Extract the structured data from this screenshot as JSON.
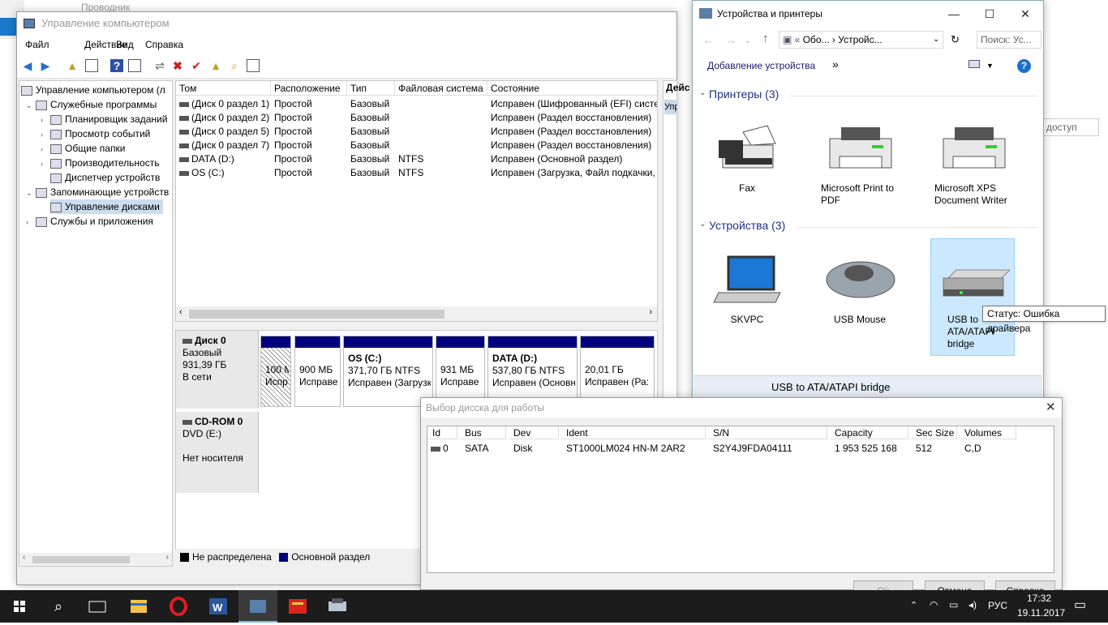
{
  "explorer_bg": {
    "title": "Проводник",
    "search_partial": "доступ"
  },
  "cm": {
    "title": "Управление компьютером",
    "menu": [
      "Файл",
      "Действие",
      "Вид",
      "Справка"
    ],
    "tree": [
      {
        "label": "Управление компьютером (л",
        "level": 0
      },
      {
        "label": "Служебные программы",
        "level": 1
      },
      {
        "label": "Планировщик заданий",
        "level": 2
      },
      {
        "label": "Просмотр событий",
        "level": 2
      },
      {
        "label": "Общие папки",
        "level": 2
      },
      {
        "label": "Производительность",
        "level": 2
      },
      {
        "label": "Диспетчер устройств",
        "level": 2
      },
      {
        "label": "Запоминающие устройств",
        "level": 1
      },
      {
        "label": "Управление дисками",
        "level": 2
      },
      {
        "label": "Службы и приложения",
        "level": 1
      }
    ],
    "columns": [
      "Том",
      "Расположение",
      "Тип",
      "Файловая система",
      "Состояние"
    ],
    "volumes": [
      [
        "(Диск 0 раздел 1)",
        "Простой",
        "Базовый",
        "",
        "Исправен (Шифрованный (EFI) систе"
      ],
      [
        "(Диск 0 раздел 2)",
        "Простой",
        "Базовый",
        "",
        "Исправен (Раздел восстановления)"
      ],
      [
        "(Диск 0 раздел 5)",
        "Простой",
        "Базовый",
        "",
        "Исправен (Раздел восстановления)"
      ],
      [
        "(Диск 0 раздел 7)",
        "Простой",
        "Базовый",
        "",
        "Исправен (Раздел восстановления)"
      ],
      [
        "DATA (D:)",
        "Простой",
        "Базовый",
        "NTFS",
        "Исправен (Основной раздел)"
      ],
      [
        "OS (C:)",
        "Простой",
        "Базовый",
        "NTFS",
        "Исправен (Загрузка, Файл подкачки,"
      ]
    ],
    "disk0": {
      "name": "Диск 0",
      "type": "Базовый",
      "size": "931,39 ГБ",
      "status": "В сети"
    },
    "partitions": [
      {
        "title": "",
        "line1": "100 М",
        "line2": "Испр"
      },
      {
        "title": "",
        "line1": "900 МБ",
        "line2": "Исправе"
      },
      {
        "title": "OS (C:)",
        "line1": "371,70 ГБ NTFS",
        "line2": "Исправен (Загрузк"
      },
      {
        "title": "",
        "line1": "931 МБ",
        "line2": "Исправе"
      },
      {
        "title": "DATA (D:)",
        "line1": "537,80 ГБ NTFS",
        "line2": "Исправен (Основн"
      },
      {
        "title": "",
        "line1": "20,01 ГБ",
        "line2": "Исправен (Ра:"
      }
    ],
    "cdrom": {
      "name": "CD-ROM 0",
      "drive": "DVD (E:)",
      "status": "Нет носителя"
    },
    "legend": [
      "Не распределена",
      "Основной раздел"
    ],
    "actions_header": "Дейс",
    "actions_item": "Управ"
  },
  "dp": {
    "title": "Устройства и принтеры",
    "address": [
      "Обо...",
      "Устройс..."
    ],
    "search_placeholder": "Поиск: Ус...",
    "add_device": "Добавление устройства",
    "more": "»",
    "printers_title": "Принтеры (3)",
    "printers": [
      "Fax",
      "Microsoft Print to PDF",
      "Microsoft XPS Document Writer"
    ],
    "devices_title": "Устройства (3)",
    "devices": [
      "SKVPC",
      "USB Mouse",
      "USB to ATA/ATAPI bridge"
    ],
    "tooltip": "Статус: Ошибка драйвера",
    "details_name": "USB to ATA/ATAPI bridge"
  },
  "sd": {
    "title": "Выбор дисска для работы",
    "columns": [
      "Id",
      "Bus",
      "Dev",
      "Ident",
      "S/N",
      "Capacity",
      "Sec Size",
      "Volumes"
    ],
    "row": [
      "0",
      "SATA",
      "Disk",
      "ST1000LM024 HN-M 2AR2",
      "S2Y4J9FDA04111",
      "1 953 525 168",
      "512",
      "C,D"
    ],
    "buttons": [
      "Ok",
      "Отмена",
      "Справка"
    ]
  },
  "taskbar": {
    "lang": "РУС",
    "time": "17:32",
    "date": "19.11.2017"
  }
}
